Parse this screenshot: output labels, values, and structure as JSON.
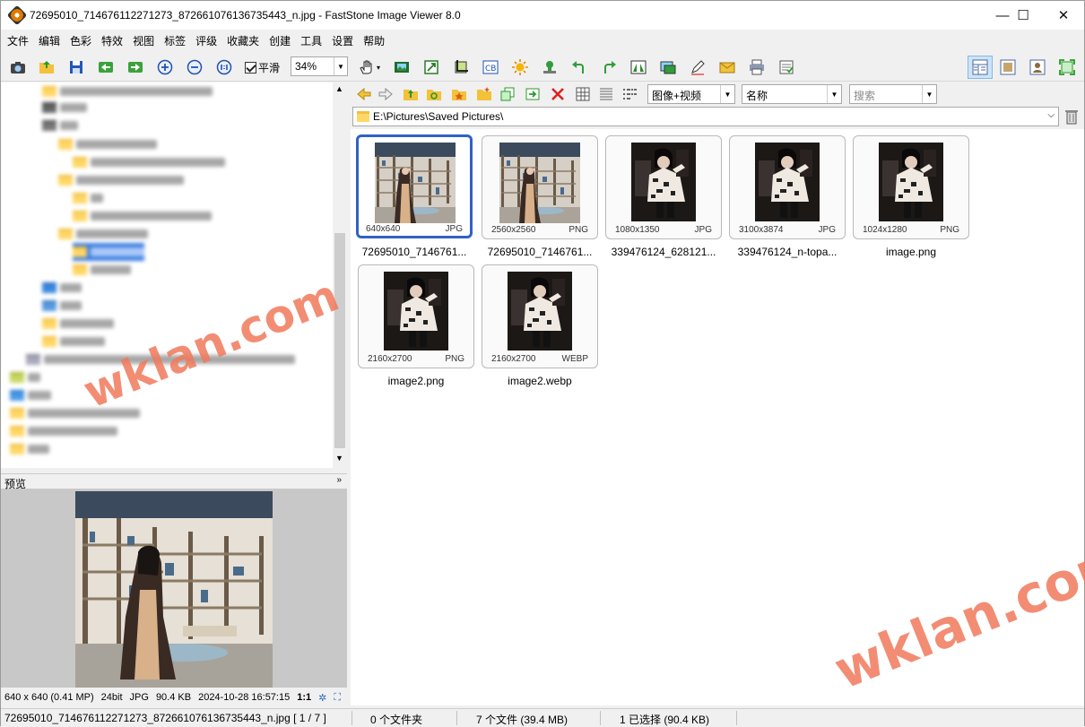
{
  "window": {
    "title": "72695010_714676112271273_872661076136735443_n.jpg  -  FastStone Image Viewer 8.0",
    "minimize": "—",
    "maximize": "☐",
    "close": "✕"
  },
  "menu": [
    "文件",
    "编辑",
    "色彩",
    "特效",
    "视图",
    "标签",
    "评级",
    "收藏夹",
    "创建",
    "工具",
    "设置",
    "帮助"
  ],
  "toolbar": {
    "smooth_label": "平滑",
    "zoom_value": "34%"
  },
  "nav": {
    "view_mode": "图像+视频",
    "sort": "名称",
    "search_placeholder": "搜索",
    "path": "E:\\Pictures\\Saved Pictures\\"
  },
  "preview": {
    "header": "预览"
  },
  "image_info": {
    "size": "640 x 640 (0.41 MP)",
    "depth": "24bit",
    "format": "JPG",
    "filesize": "90.4 KB",
    "date": "2024-10-28 16:57:15",
    "ratio": "1:1"
  },
  "thumbnails": [
    {
      "dim": "640x640",
      "fmt": "JPG",
      "name": "72695010_7146761...",
      "kind": "library",
      "selected": true
    },
    {
      "dim": "2560x2560",
      "fmt": "PNG",
      "name": "72695010_7146761...",
      "kind": "library",
      "selected": false
    },
    {
      "dim": "1080x1350",
      "fmt": "JPG",
      "name": "339476124_628121...",
      "kind": "dark",
      "selected": false
    },
    {
      "dim": "3100x3874",
      "fmt": "JPG",
      "name": "339476124_n-topa...",
      "kind": "dark",
      "selected": false
    },
    {
      "dim": "1024x1280",
      "fmt": "PNG",
      "name": "image.png",
      "kind": "dark",
      "selected": false
    },
    {
      "dim": "2160x2700",
      "fmt": "PNG",
      "name": "image2.png",
      "kind": "dark",
      "selected": false
    },
    {
      "dim": "2160x2700",
      "fmt": "WEBP",
      "name": "image2.webp",
      "kind": "dark",
      "selected": false
    }
  ],
  "status": {
    "file": "72695010_714676112271273_872661076136735443_n.jpg [ 1 / 7 ]",
    "folders": "0 个文件夹",
    "files": "7 个文件 (39.4 MB)",
    "selected": "1 已选择 (90.4 KB)"
  },
  "watermark": "wklan.com"
}
